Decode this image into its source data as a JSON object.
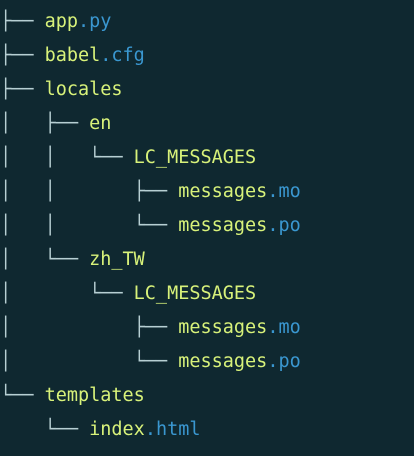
{
  "tree": {
    "rows": [
      {
        "prefix": "├── ",
        "name": "app",
        "ext": ".py"
      },
      {
        "prefix": "├── ",
        "name": "babel",
        "ext": ".cfg"
      },
      {
        "prefix": "├── ",
        "name": "locales",
        "ext": ""
      },
      {
        "prefix": "│   ├── ",
        "name": "en",
        "ext": ""
      },
      {
        "prefix": "│   │   └── ",
        "name": "LC_MESSAGES",
        "ext": ""
      },
      {
        "prefix": "│   │       ├── ",
        "name": "messages",
        "ext": ".mo"
      },
      {
        "prefix": "│   │       └── ",
        "name": "messages",
        "ext": ".po"
      },
      {
        "prefix": "│   └── ",
        "name": "zh_TW",
        "ext": ""
      },
      {
        "prefix": "│       └── ",
        "name": "LC_MESSAGES",
        "ext": ""
      },
      {
        "prefix": "│           ├── ",
        "name": "messages",
        "ext": ".mo"
      },
      {
        "prefix": "│           └── ",
        "name": "messages",
        "ext": ".po"
      },
      {
        "prefix": "└── ",
        "name": "templates",
        "ext": ""
      },
      {
        "prefix": "    └── ",
        "name": "index",
        "ext": ".html"
      }
    ]
  },
  "colors": {
    "background": "#0f2830",
    "branch": "#b7cfd3",
    "name": "#d8f27a",
    "extension": "#3a97d0"
  }
}
